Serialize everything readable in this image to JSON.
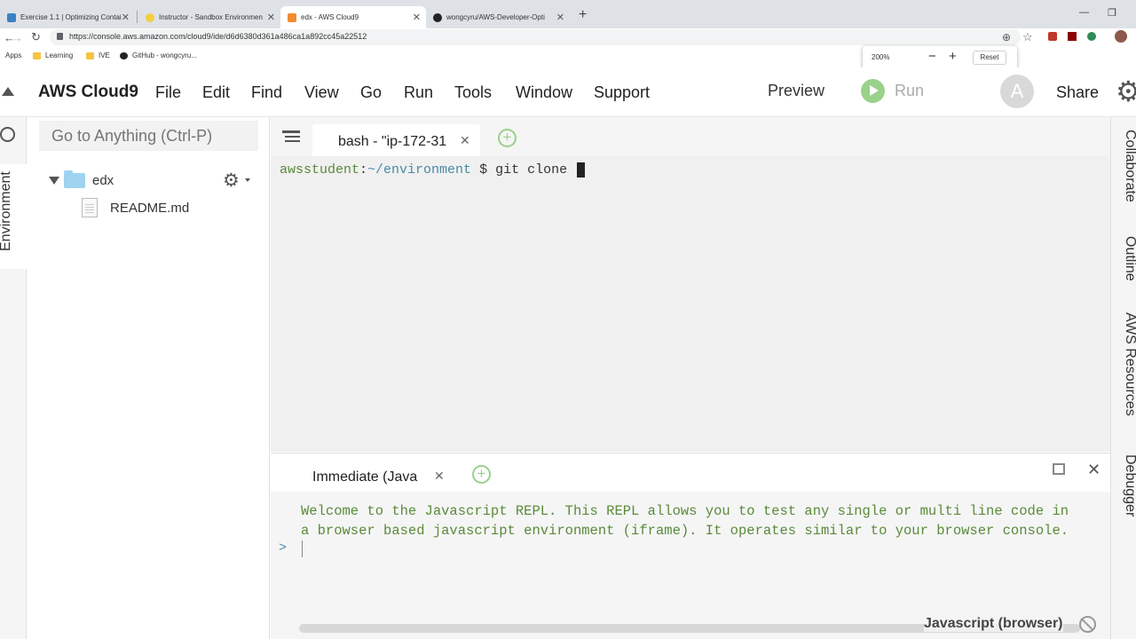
{
  "browser": {
    "tabs": [
      {
        "title": "Exercise 1.1 | Optimizing Contai"
      },
      {
        "title": "Instructor - Sandbox Environmen"
      },
      {
        "title": "edx - AWS Cloud9"
      },
      {
        "title": "wongcyru/AWS-Developer-Opti"
      }
    ],
    "url": "https://console.aws.amazon.com/cloud9/ide/d6d6380d361a486ca1a892cc45a22512",
    "bookmarks": [
      "Apps",
      "Learning",
      "IVE",
      "GitHub - wongcyru..."
    ],
    "zoom": {
      "value": "200%",
      "reset_label": "Reset"
    }
  },
  "menubar": {
    "brand": "AWS Cloud9",
    "items": [
      "File",
      "Edit",
      "Find",
      "View",
      "Go",
      "Run",
      "Tools",
      "Window",
      "Support"
    ],
    "preview": "Preview",
    "run": "Run",
    "avatar": "A",
    "share": "Share"
  },
  "sidebar": {
    "env_tab": "Environment",
    "search_placeholder": "Go to Anything (Ctrl-P)",
    "tree": {
      "folder": "edx",
      "files": [
        "README.md"
      ]
    }
  },
  "editor": {
    "tab_label": "bash - \"ip-172-31",
    "prompt_user": "awsstudent",
    "prompt_path": "~/environment",
    "command": " $ git clone "
  },
  "console": {
    "tab_label": "Immediate (Java",
    "welcome_line1": "Welcome to the Javascript REPL. This REPL allows you to test any single or multi line code in",
    "welcome_line2": "a browser based javascript environment (iframe). It operates similar to your browser console.",
    "prompt": ">",
    "runtime": "Javascript (browser)"
  },
  "right_panel": {
    "tabs": [
      "Collaborate",
      "Outline",
      "AWS Resources",
      "Debugger"
    ]
  }
}
